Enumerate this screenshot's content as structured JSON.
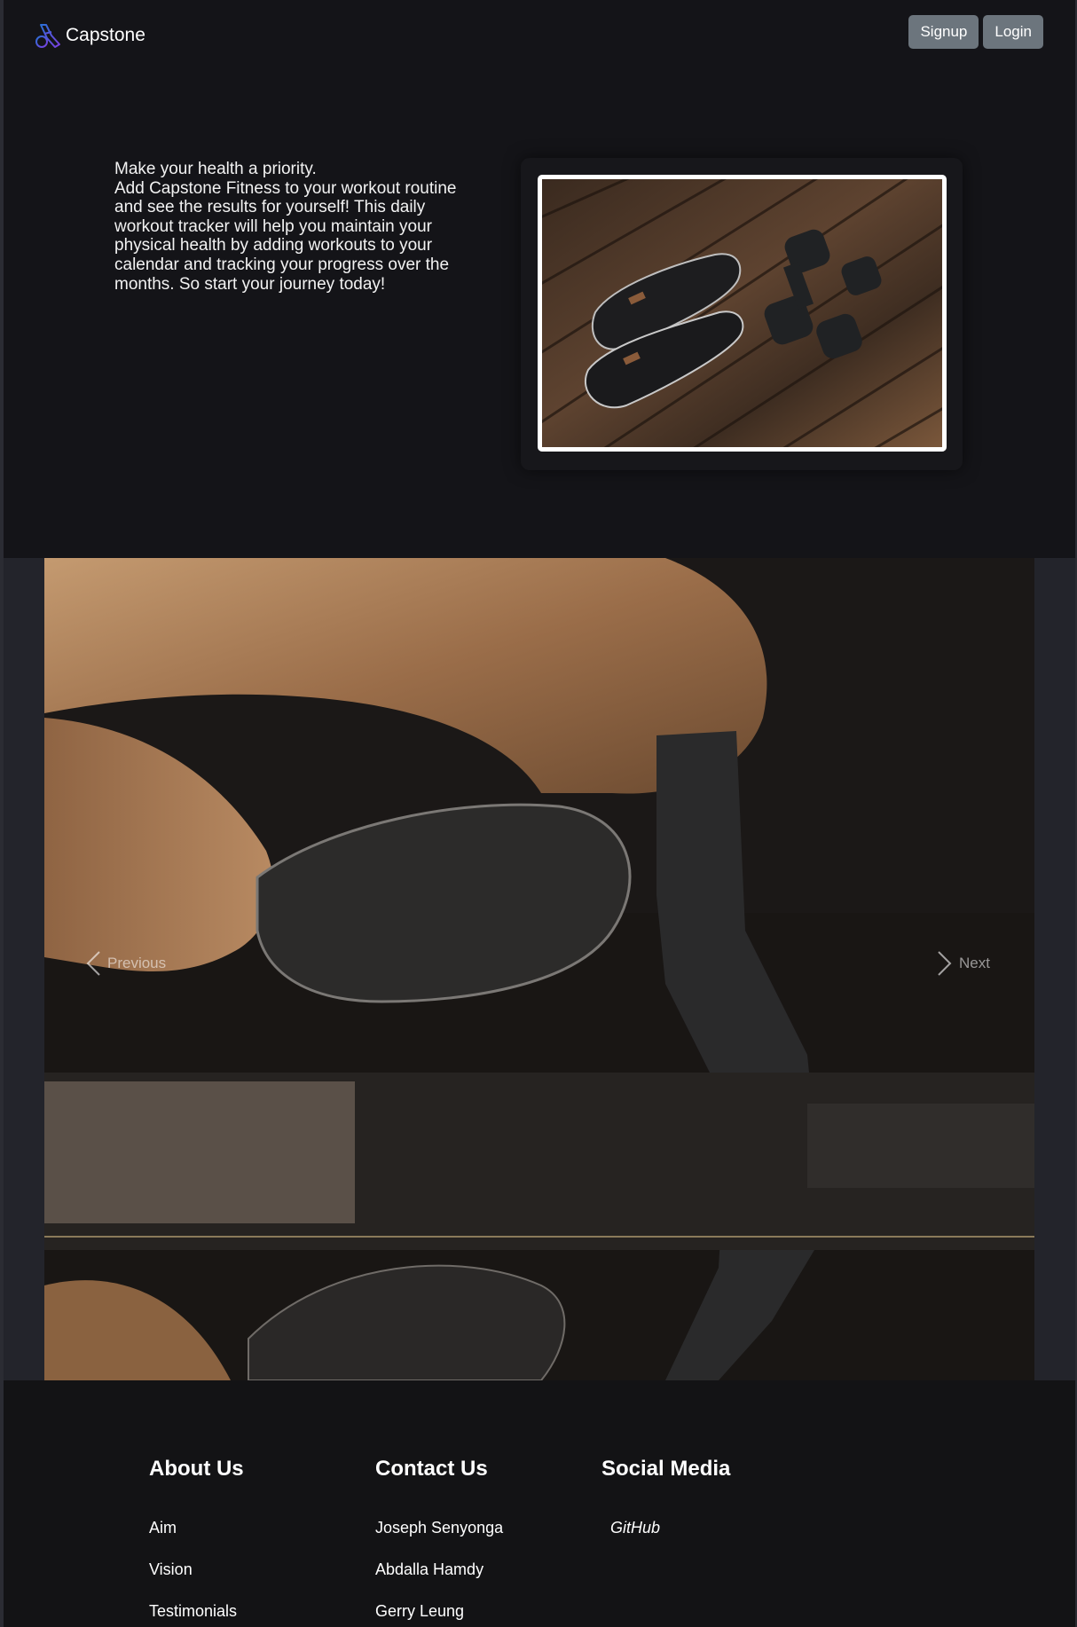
{
  "navbar": {
    "brand_name": "Capstone",
    "brand_icon": "capstone-logo-icon",
    "signup_label": "Signup",
    "login_label": "Login",
    "button_color": "#6c757d"
  },
  "hero": {
    "line1": "Make your health a priority.",
    "line2": "Add Capstone Fitness to your workout routine and see the results for yourself! This daily workout tracker will help you maintain your physical health by adding workouts to your calendar and tracking your progress over the months. So start your journey today!"
  },
  "carousel": {
    "prev_label": "Previous",
    "next_label": "Next",
    "prev_icon": "chevron-left-icon",
    "next_icon": "chevron-right-icon"
  },
  "footer": {
    "about": {
      "heading": "About Us",
      "links": [
        "Aim",
        "Vision",
        "Testimonials"
      ]
    },
    "contact": {
      "heading": "Contact Us",
      "links": [
        "Joseph Senyonga",
        "Abdalla Hamdy",
        "Gerry Leung"
      ]
    },
    "social": {
      "heading": "Social Media",
      "links": [
        "GitHub"
      ]
    }
  }
}
